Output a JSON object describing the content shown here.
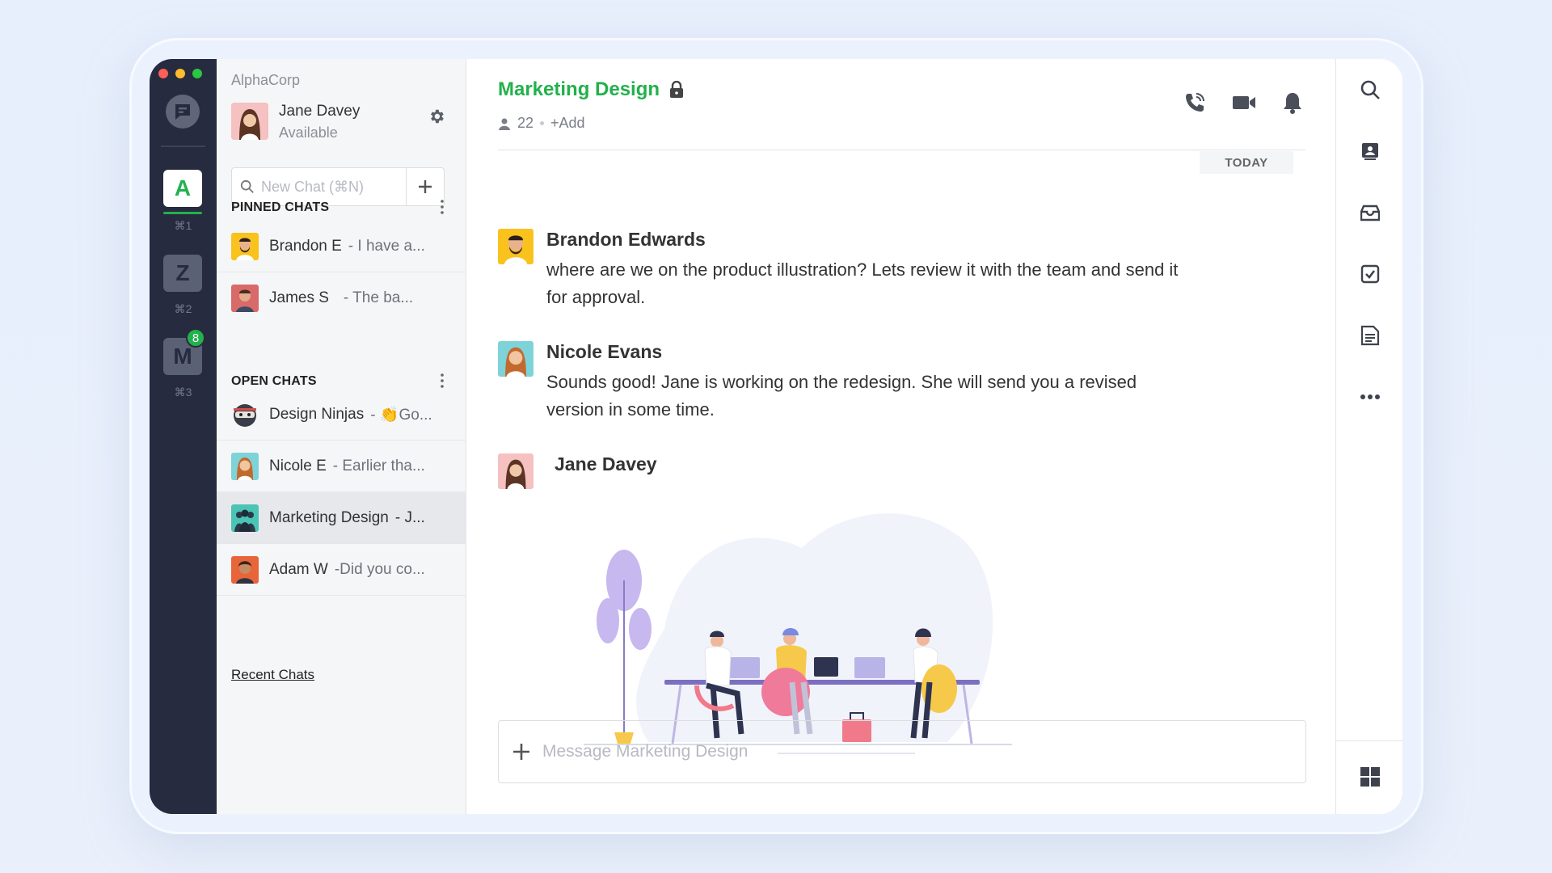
{
  "colors": {
    "accent": "#22b14c",
    "rail": "#262b3f",
    "badge": "#22b14c"
  },
  "workspace": {
    "org": "AlphaCorp"
  },
  "me": {
    "name": "Jane Davey",
    "status": "Available"
  },
  "rail": {
    "workspaces": [
      {
        "letter": "A",
        "shortcut": "⌘1"
      },
      {
        "letter": "Z",
        "shortcut": "⌘2"
      },
      {
        "letter": "M",
        "shortcut": "⌘3",
        "badge": "8"
      }
    ]
  },
  "search": {
    "placeholder": "New Chat (⌘N)"
  },
  "pinned": {
    "title": "PINNED CHATS",
    "items": [
      {
        "name": "Brandon E",
        "preview": "- I have a..."
      },
      {
        "name": "James S",
        "preview": "- The ba..."
      }
    ]
  },
  "open": {
    "title": "OPEN CHATS",
    "items": [
      {
        "name": "Design Ninjas",
        "preview": "- 👏Go..."
      },
      {
        "name": "Nicole E",
        "preview": "- Earlier tha..."
      },
      {
        "name": "Marketing Design",
        "preview": "- J..."
      },
      {
        "name": "Adam W",
        "preview": "-Did you co..."
      }
    ]
  },
  "recent_link": "Recent Chats",
  "channel": {
    "title": "Marketing Design",
    "members": "22",
    "add": "+Add",
    "date_divider": "TODAY"
  },
  "messages": [
    {
      "author": "Brandon Edwards",
      "text": "where are we on the product illustration? Lets review it with the team and send it for approval."
    },
    {
      "author": "Nicole Evans",
      "text": "Sounds good! Jane is working on the redesign. She will send you a revised version in some time."
    },
    {
      "author": "Jane Davey",
      "text": ""
    }
  ],
  "composer": {
    "placeholder": "Message Marketing Design"
  },
  "icons": [
    "search-icon",
    "contacts-icon",
    "archive-icon",
    "tasks-icon",
    "notes-icon",
    "more-icon",
    "apps-grid-icon",
    "phone-icon",
    "video-icon",
    "bell-icon",
    "lock-icon",
    "gear-icon",
    "plus-icon"
  ]
}
